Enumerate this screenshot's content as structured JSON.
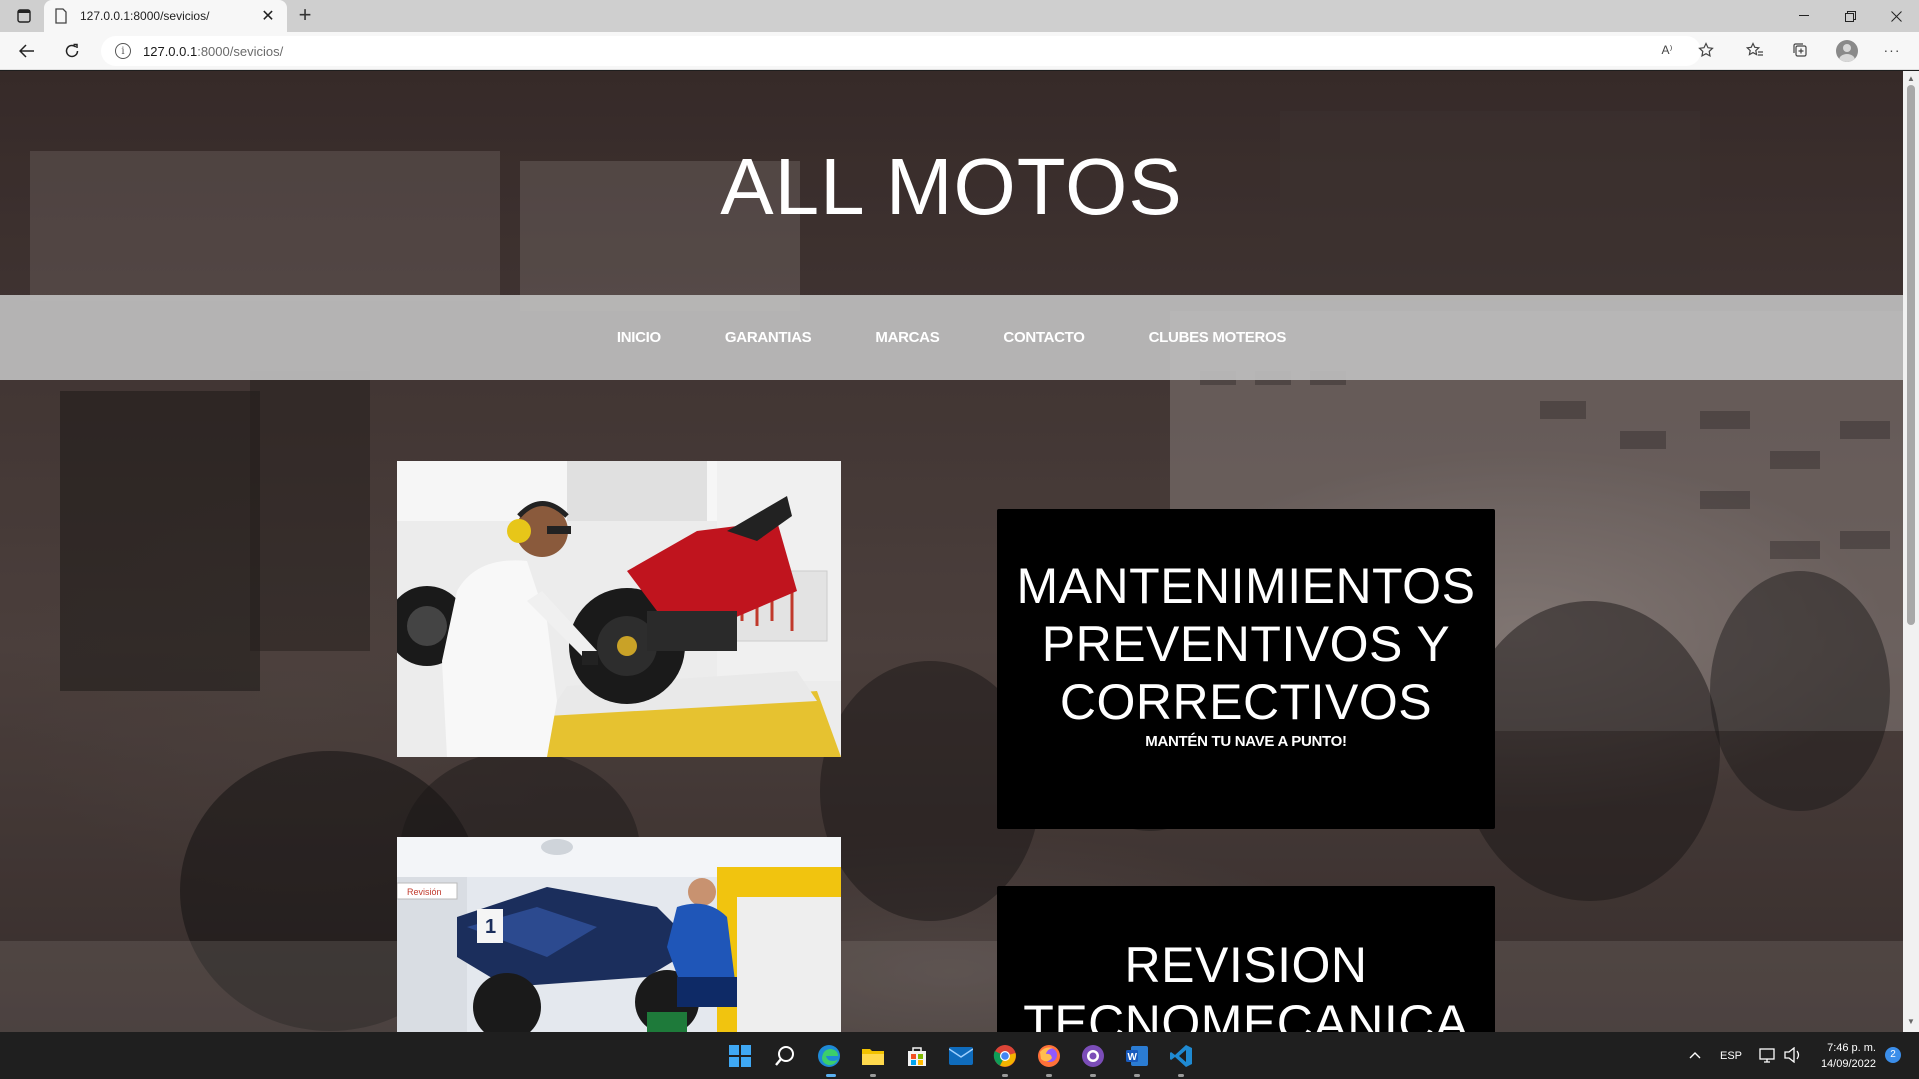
{
  "browser": {
    "tab_title": "127.0.0.1:8000/sevicios/",
    "tab_close": "✕",
    "new_tab": "+",
    "url_host": "127.0.0.1",
    "url_path": ":8000/sevicios/",
    "info_icon": "i",
    "read_aloud": "A⁾",
    "more_menu": "···"
  },
  "site": {
    "title": "ALL MOTOS",
    "nav": [
      "INICIO",
      "GARANTIAS",
      "MARCAS",
      "CONTACTO",
      "CLUBES MOTEROS"
    ]
  },
  "services": [
    {
      "title_lines": [
        "MANTENIMIENTOS",
        "PREVENTIVOS Y",
        "CORRECTIVOS"
      ],
      "subtitle": "MANTÉN TU NAVE A PUNTO!"
    },
    {
      "title_lines": [
        "REVISION",
        "TECNOMECANICA"
      ]
    }
  ],
  "image_labels": {
    "revision_sign": "Revisión",
    "bike_number": "1"
  },
  "taskbar": {
    "language": "ESP",
    "time": "7:46 p. m.",
    "date": "14/09/2022",
    "notification_count": "2"
  },
  "colors": {
    "navbar": "#bebebe",
    "card_bg": "#000000",
    "title_text": "#ffffff",
    "taskbar": "#1f1f1f"
  }
}
